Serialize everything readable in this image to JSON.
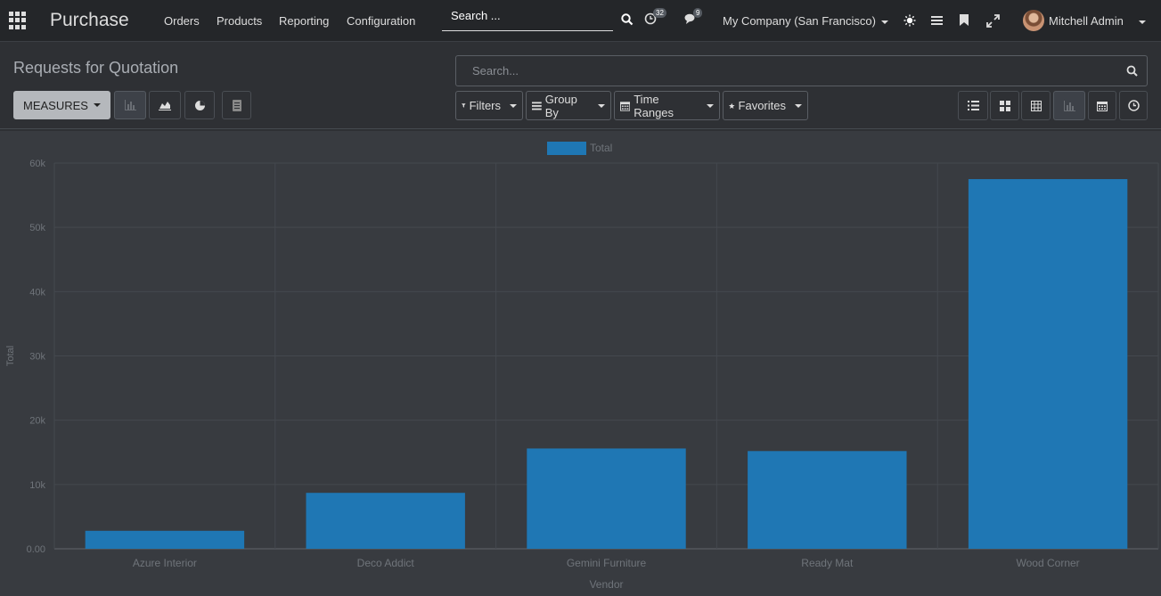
{
  "navbar": {
    "app_name": "Purchase",
    "menu": [
      "Orders",
      "Products",
      "Reporting",
      "Configuration"
    ],
    "search_placeholder": "Search ...",
    "activity_count": "32",
    "messages_count": "9",
    "company": "My Company (San Francisco)",
    "user": "Mitchell Admin"
  },
  "control_panel": {
    "breadcrumb": "Requests for Quotation",
    "measures_label": "MEASURES",
    "search_placeholder": "Search...",
    "filters": [
      "Filters",
      "Group By",
      "Time Ranges",
      "Favorites"
    ]
  },
  "chart_data": {
    "type": "bar",
    "categories": [
      "Azure Interior",
      "Deco Addict",
      "Gemini Furniture",
      "Ready Mat",
      "Wood Corner"
    ],
    "series": [
      {
        "name": "Total",
        "values": [
          2800,
          8700,
          15600,
          15200,
          57500
        ]
      }
    ],
    "xlabel": "Vendor",
    "ylabel": "Total",
    "ylim": [
      0,
      60000
    ],
    "y_ticks": [
      "0.00",
      "10k",
      "20k",
      "30k",
      "40k",
      "50k",
      "60k"
    ],
    "bar_color": "#1f77b4",
    "legend": "top-center",
    "grid": true
  }
}
